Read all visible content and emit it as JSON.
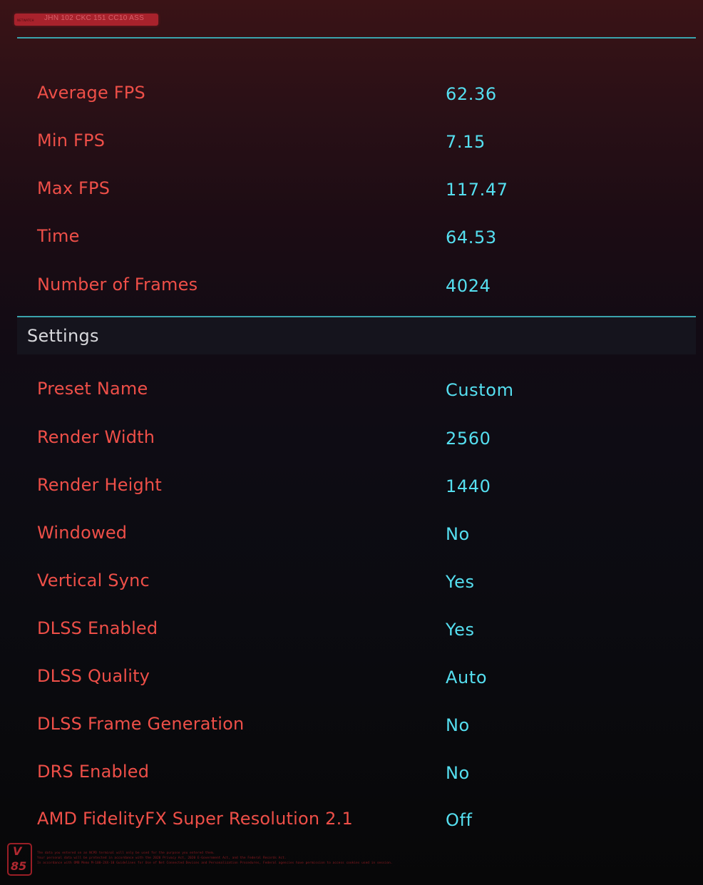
{
  "header": {
    "tag_small": "NETWATCH",
    "tag_code": "JHN 102 CKC 151 CC10 ASS"
  },
  "results": [
    {
      "label": "Average FPS",
      "value": "62.36"
    },
    {
      "label": "Min FPS",
      "value": "7.15"
    },
    {
      "label": "Max FPS",
      "value": "117.47"
    },
    {
      "label": "Time",
      "value": "64.53"
    },
    {
      "label": "Number of Frames",
      "value": "4024"
    }
  ],
  "settings": {
    "title": "Settings",
    "items": [
      {
        "label": "Preset Name",
        "value": "Custom"
      },
      {
        "label": "Render Width",
        "value": "2560"
      },
      {
        "label": "Render Height",
        "value": "1440"
      },
      {
        "label": "Windowed",
        "value": "No"
      },
      {
        "label": "Vertical Sync",
        "value": "Yes"
      },
      {
        "label": "DLSS Enabled",
        "value": "Yes"
      },
      {
        "label": "DLSS Quality",
        "value": "Auto"
      },
      {
        "label": "DLSS Frame Generation",
        "value": "No"
      },
      {
        "label": "DRS Enabled",
        "value": "No"
      },
      {
        "label": "AMD FidelityFX Super Resolution 2.1",
        "value": "Off"
      }
    ]
  },
  "footer": {
    "badge_line1": "V",
    "badge_line2": "85",
    "lines": [
      "The data you entered on an NCPD terminal will only be used for the purpose you entered them.",
      "Your personal data will be protected in accordance with the 2020 Privacy Act, 2020 E-Government Act, and the Federal Records Act.",
      "In accordance with OMB Memo M-100-2XX-10 Guidelines for Use of Net Connected Devices and Personalization Procedures, Federal agencies have permission to access cookies used in session."
    ]
  },
  "colors": {
    "label": "#ee4f48",
    "value": "#55dff0",
    "divider": "#3aa3ad",
    "accent": "#a8222c"
  }
}
